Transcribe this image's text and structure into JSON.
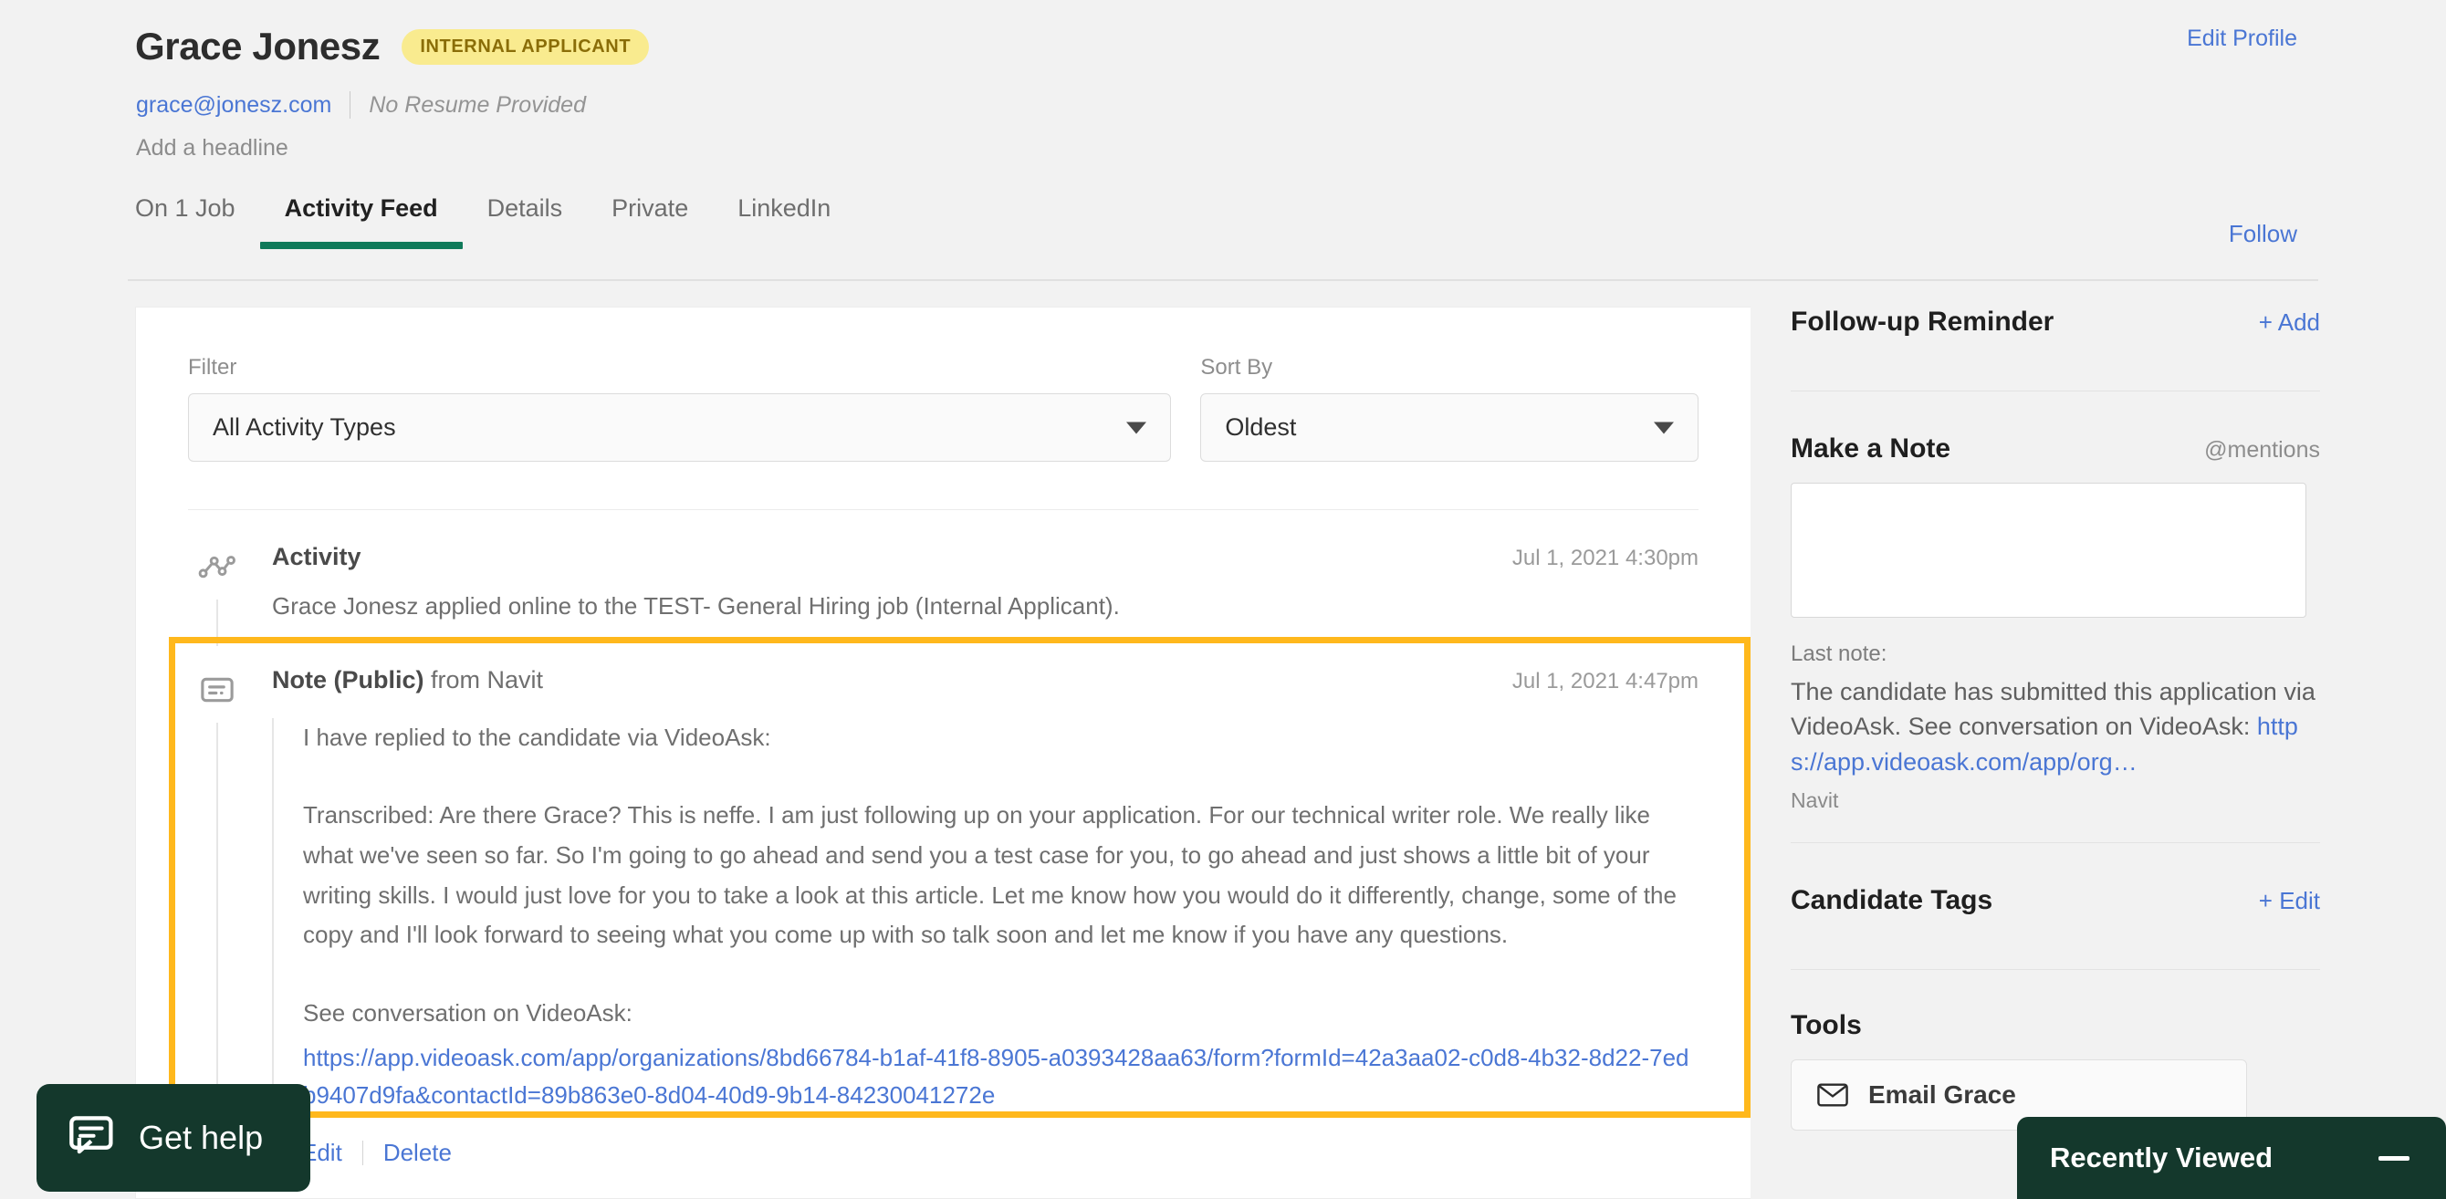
{
  "header": {
    "candidate_name": "Grace Jonesz",
    "badge": "INTERNAL APPLICANT",
    "email": "grace@jonesz.com",
    "resume_status": "No Resume Provided",
    "headline_placeholder": "Add a headline",
    "edit_profile": "Edit Profile",
    "follow": "Follow"
  },
  "tabs": [
    {
      "label": "On 1 Job",
      "active": false
    },
    {
      "label": "Activity Feed",
      "active": true
    },
    {
      "label": "Details",
      "active": false
    },
    {
      "label": "Private",
      "active": false
    },
    {
      "label": "LinkedIn",
      "active": false
    }
  ],
  "controls": {
    "filter_label": "Filter",
    "filter_value": "All Activity Types",
    "sort_label": "Sort By",
    "sort_value": "Oldest"
  },
  "feed": {
    "activity": {
      "title": "Activity",
      "timestamp": "Jul 1, 2021 4:30pm",
      "text": "Grace Jonesz applied online to the TEST- General Hiring job (Internal Applicant)."
    },
    "note": {
      "title": "Note (Public)",
      "subtitle": "from Navit",
      "timestamp": "Jul 1, 2021 4:47pm",
      "paragraph1": "I have replied to the candidate via VideoAsk:",
      "paragraph2": "Transcribed: Are there Grace? This is neffe. I am just following up on your application. For our technical writer role. We really like what we've seen so far. So I'm going to go ahead and send you a test case for you, to go ahead and just shows a little bit of your writing skills. I would just love for you to take a look at this article. Let me know how you would do it differently, change, some of the copy and I'll look forward to seeing what you come up with so talk soon and let me know if you have any questions.",
      "paragraph3": "See conversation on VideoAsk:",
      "link": "https://app.videoask.com/app/organizations/8bd66784-b1af-41f8-8905-a0393428aa63/form?formId=42a3aa02-c0d8-4b32-8d22-7edb9407d9fa&contactId=89b863e0-8d04-40d9-9b14-84230041272e",
      "edit": "Edit",
      "delete": "Delete"
    }
  },
  "sidebar": {
    "followup_title": "Follow-up Reminder",
    "followup_action": "+ Add",
    "make_note_title": "Make a Note",
    "mentions_hint": "@mentions",
    "last_note_label": "Last note:",
    "last_note_text_before": "The candidate has submitted this application via VideoAsk. See conversation on VideoAsk: ",
    "last_note_link": "https://app.videoask.com/app/org…",
    "last_note_author": "Navit",
    "tags_title": "Candidate Tags",
    "tags_action": "+ Edit",
    "tools_title": "Tools",
    "email_tool_label": "Email Grace"
  },
  "overlays": {
    "get_help": "Get help",
    "recently_viewed": "Recently Viewed"
  },
  "colors": {
    "accent_green": "#107a5a",
    "link_blue": "#4a76d4",
    "badge_yellow": "#f9eb8f",
    "highlight_orange": "#ffb81c",
    "dark_green": "#14382c"
  }
}
